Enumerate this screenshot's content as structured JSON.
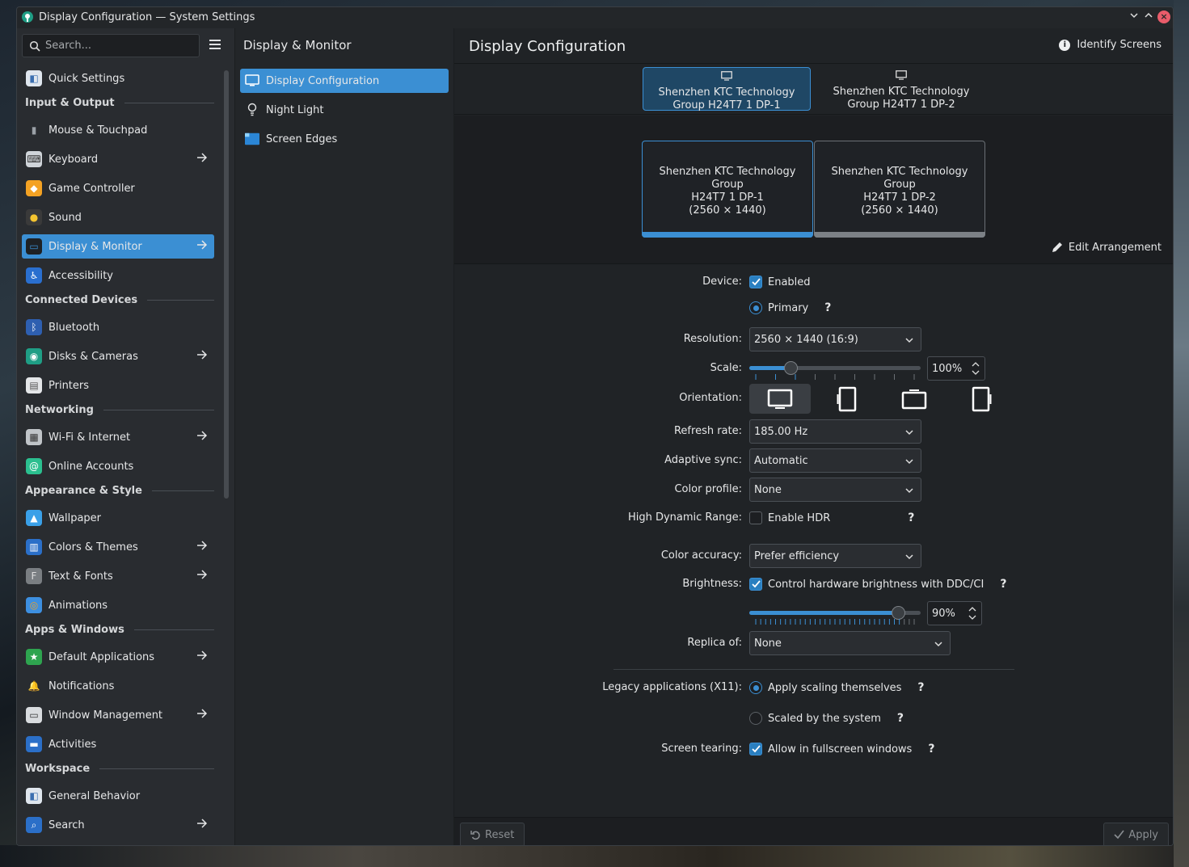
{
  "window": {
    "title": "Display Configuration — System Settings"
  },
  "sidebar": {
    "search_placeholder": "Search...",
    "items": [
      {
        "type": "item",
        "label": "Quick Settings",
        "icon": "quick-settings-icon",
        "arrow": false
      },
      {
        "type": "section",
        "label": "Input & Output"
      },
      {
        "type": "item",
        "label": "Mouse & Touchpad",
        "icon": "mouse-icon",
        "arrow": false
      },
      {
        "type": "item",
        "label": "Keyboard",
        "icon": "keyboard-icon",
        "arrow": true
      },
      {
        "type": "item",
        "label": "Game Controller",
        "icon": "gamepad-icon",
        "arrow": false
      },
      {
        "type": "item",
        "label": "Sound",
        "icon": "speaker-icon",
        "arrow": false
      },
      {
        "type": "item",
        "label": "Display & Monitor",
        "icon": "monitor-icon",
        "arrow": true,
        "active": true
      },
      {
        "type": "item",
        "label": "Accessibility",
        "icon": "accessibility-icon",
        "arrow": false
      },
      {
        "type": "section",
        "label": "Connected Devices"
      },
      {
        "type": "item",
        "label": "Bluetooth",
        "icon": "bluetooth-icon",
        "arrow": false
      },
      {
        "type": "item",
        "label": "Disks & Cameras",
        "icon": "disks-icon",
        "arrow": true
      },
      {
        "type": "item",
        "label": "Printers",
        "icon": "printer-icon",
        "arrow": false
      },
      {
        "type": "section",
        "label": "Networking"
      },
      {
        "type": "item",
        "label": "Wi-Fi & Internet",
        "icon": "network-icon",
        "arrow": true
      },
      {
        "type": "item",
        "label": "Online Accounts",
        "icon": "online-accounts-icon",
        "arrow": false
      },
      {
        "type": "section",
        "label": "Appearance & Style"
      },
      {
        "type": "item",
        "label": "Wallpaper",
        "icon": "wallpaper-icon",
        "arrow": false
      },
      {
        "type": "item",
        "label": "Colors & Themes",
        "icon": "colors-icon",
        "arrow": true
      },
      {
        "type": "item",
        "label": "Text & Fonts",
        "icon": "fonts-icon",
        "arrow": true
      },
      {
        "type": "item",
        "label": "Animations",
        "icon": "animations-icon",
        "arrow": false
      },
      {
        "type": "section",
        "label": "Apps & Windows"
      },
      {
        "type": "item",
        "label": "Default Applications",
        "icon": "default-apps-icon",
        "arrow": true
      },
      {
        "type": "item",
        "label": "Notifications",
        "icon": "bell-icon",
        "arrow": false
      },
      {
        "type": "item",
        "label": "Window Management",
        "icon": "window-management-icon",
        "arrow": true
      },
      {
        "type": "item",
        "label": "Activities",
        "icon": "activities-icon",
        "arrow": false
      },
      {
        "type": "section",
        "label": "Workspace"
      },
      {
        "type": "item",
        "label": "General Behavior",
        "icon": "general-behavior-icon",
        "arrow": false
      },
      {
        "type": "item",
        "label": "Search",
        "icon": "search-icon",
        "arrow": true
      }
    ]
  },
  "middle": {
    "title": "Display & Monitor",
    "items": [
      {
        "label": "Display Configuration",
        "icon": "monitor-icon",
        "active": true
      },
      {
        "label": "Night Light",
        "icon": "lightbulb-icon",
        "active": false
      },
      {
        "label": "Screen Edges",
        "icon": "screen-edges-icon",
        "active": false
      }
    ]
  },
  "main": {
    "title": "Display Configuration",
    "identify_label": "Identify Screens",
    "screens": [
      {
        "line1": "Shenzhen KTC Technology",
        "line2": "Group H24T7 1 DP-1",
        "active": true
      },
      {
        "line1": "Shenzhen KTC Technology",
        "line2": "Group H24T7 1 DP-2",
        "active": false
      }
    ],
    "arrangement": [
      {
        "line1": "Shenzhen KTC Technology Group",
        "line2": "H24T7 1 DP-1",
        "line3": "(2560 × 1440)",
        "selected": true
      },
      {
        "line1": "Shenzhen KTC Technology Group",
        "line2": "H24T7 1 DP-2",
        "line3": "(2560 × 1440)",
        "selected": false
      }
    ],
    "edit_arrangement": "Edit Arrangement",
    "form": {
      "device_label": "Device:",
      "enabled_label": "Enabled",
      "primary_label": "Primary",
      "resolution_label": "Resolution:",
      "resolution_value": "2560 × 1440 (16:9)",
      "scale_label": "Scale:",
      "scale_value": "100%",
      "scale_fraction": 0.22,
      "orientation_label": "Orientation:",
      "refresh_label": "Refresh rate:",
      "refresh_value": "185.00 Hz",
      "adaptive_label": "Adaptive sync:",
      "adaptive_value": "Automatic",
      "color_profile_label": "Color profile:",
      "color_profile_value": "None",
      "hdr_label": "High Dynamic Range:",
      "hdr_check_label": "Enable HDR",
      "accuracy_label": "Color accuracy:",
      "accuracy_value": "Prefer efficiency",
      "brightness_label": "Brightness:",
      "ddc_label": "Control hardware brightness with DDC/CI",
      "brightness_value": "90%",
      "brightness_fraction": 0.9,
      "replica_label": "Replica of:",
      "replica_value": "None",
      "legacy_label": "Legacy applications (X11):",
      "legacy_opt1": "Apply scaling themselves",
      "legacy_opt2": "Scaled by the system",
      "tearing_label": "Screen tearing:",
      "tearing_check": "Allow in fullscreen windows",
      "help_glyph": "?"
    },
    "reset_label": "Reset",
    "apply_label": "Apply"
  },
  "colors": {
    "accent": "#3b8fd3",
    "window_bg": "#202326",
    "sidebar_bg": "#292c30"
  }
}
